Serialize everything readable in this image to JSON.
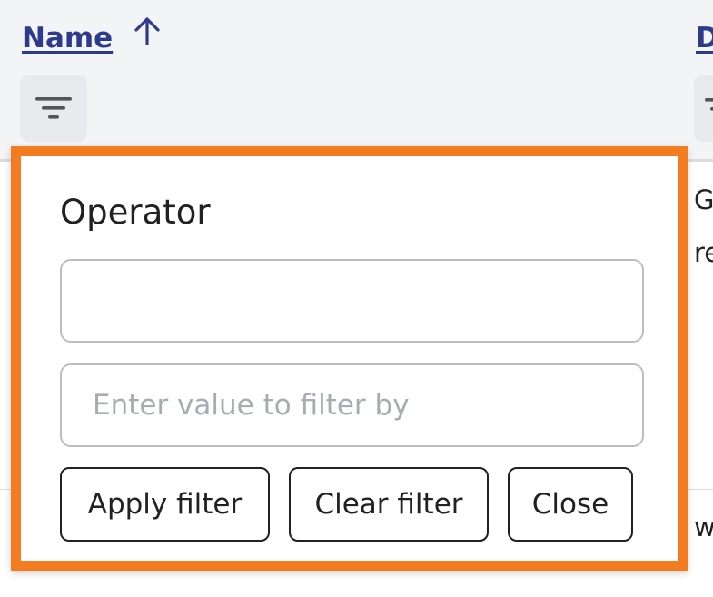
{
  "table": {
    "columns": [
      {
        "label": "Name",
        "sort": "ascending",
        "sort_icon": "arrow-up-icon",
        "filter_icon": "filter-icon"
      },
      {
        "label": "D",
        "filter_icon": "filter-icon"
      }
    ],
    "rows": [
      {
        "cell_lines": [
          "G",
          "re"
        ]
      },
      {
        "cell_lines": [
          "w"
        ]
      }
    ]
  },
  "filter_popover": {
    "operator_label": "Operator",
    "operator_value": "",
    "value_placeholder": "Enter value to filter by",
    "value": "",
    "buttons": {
      "apply": "Apply filter",
      "clear": "Clear filter",
      "close": "Close"
    }
  },
  "colors": {
    "link": "#2e3a8c",
    "highlight_border": "#f47c20",
    "header_bg": "#f3f4f6",
    "placeholder": "#a8acb2"
  }
}
